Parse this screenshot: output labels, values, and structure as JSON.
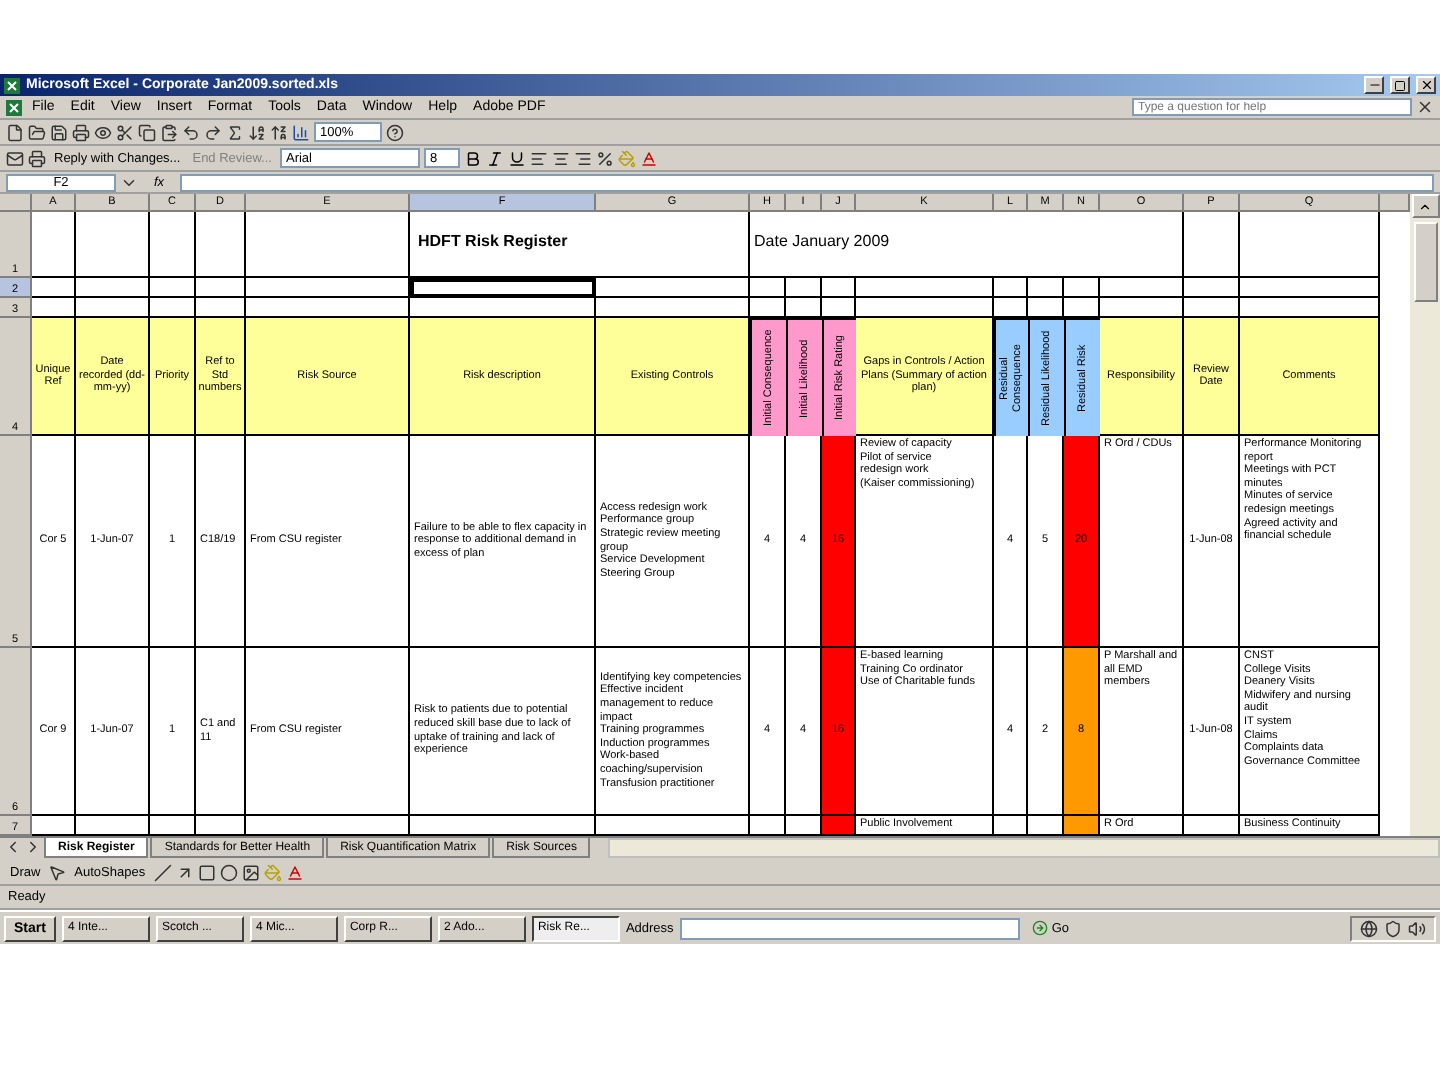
{
  "window": {
    "title": "Microsoft Excel - Corporate Jan2009.sorted.xls"
  },
  "menu": [
    "File",
    "Edit",
    "View",
    "Insert",
    "Format",
    "Tools",
    "Data",
    "Window",
    "Help",
    "Adobe PDF"
  ],
  "help_box": {
    "placeholder": "Type a question for help"
  },
  "toolbar": {
    "zoom": "100%",
    "review_buttons": [
      "Reply with Changes...",
      "End Review..."
    ],
    "font": "Arial",
    "font_size": "8"
  },
  "formula_bar": {
    "name_box": "F2",
    "fx": "fx"
  },
  "sheet": {
    "columns": [
      {
        "letter": "A",
        "selected": false
      },
      {
        "letter": "B",
        "selected": false
      },
      {
        "letter": "C",
        "selected": false
      },
      {
        "letter": "D",
        "selected": false
      },
      {
        "letter": "E",
        "selected": false
      },
      {
        "letter": "F",
        "selected": true
      },
      {
        "letter": "G",
        "selected": false
      },
      {
        "letter": "H",
        "selected": false
      },
      {
        "letter": "I",
        "selected": false
      },
      {
        "letter": "J",
        "selected": false
      },
      {
        "letter": "K",
        "selected": false
      },
      {
        "letter": "L",
        "selected": false
      },
      {
        "letter": "M",
        "selected": false
      },
      {
        "letter": "N",
        "selected": false
      },
      {
        "letter": "O",
        "selected": false
      },
      {
        "letter": "P",
        "selected": false
      },
      {
        "letter": "Q",
        "selected": false
      }
    ],
    "rows": [
      {
        "kind": "title",
        "number": "1",
        "selected": false,
        "title": "HDFT Risk Register",
        "date": "Date  January 2009"
      },
      {
        "kind": "blank",
        "number": "2",
        "selected": true
      },
      {
        "kind": "blank",
        "number": "3",
        "selected": false
      },
      {
        "kind": "header",
        "number": "4",
        "selected": false,
        "cells": [
          {
            "text": "Unique Ref",
            "vertical": false,
            "color": "#ffff99"
          },
          {
            "text": "Date recorded (dd-mm-yy)",
            "vertical": false,
            "color": "#ffff99"
          },
          {
            "text": "Priority",
            "vertical": false,
            "color": "#ffff99"
          },
          {
            "text": "Ref to Std numbers",
            "vertical": false,
            "color": "#ffff99"
          },
          {
            "text": "Risk Source",
            "vertical": false,
            "color": "#ffff99"
          },
          {
            "text": "Risk description",
            "vertical": false,
            "color": "#ffff99"
          },
          {
            "text": "Existing Controls",
            "vertical": false,
            "color": "#ffff99"
          },
          {
            "text": "Initial Consequence",
            "vertical": true,
            "color": "#ff99cc"
          },
          {
            "text": "Initial Likelihood",
            "vertical": true,
            "color": "#ff99cc"
          },
          {
            "text": "Initial Risk Rating",
            "vertical": true,
            "color": "#ff99cc"
          },
          {
            "text": "Gaps in Controls / Action Plans (Summary of action plan)",
            "vertical": false,
            "color": "#ffff99"
          },
          {
            "text": "Residual Consequence",
            "vertical": true,
            "color": "#99ccff"
          },
          {
            "text": "Residual Likelihood",
            "vertical": true,
            "color": "#99ccff"
          },
          {
            "text": "Residual Risk",
            "vertical": true,
            "color": "#99ccff"
          },
          {
            "text": "Responsibility",
            "vertical": false,
            "color": "#ffff99"
          },
          {
            "text": "Review Date",
            "vertical": false,
            "color": "#ffff99"
          },
          {
            "text": "Comments",
            "vertical": false,
            "color": "#ffff99"
          }
        ]
      },
      {
        "kind": "data",
        "number": "5",
        "selected": false,
        "cells": [
          {
            "text": "Cor 5"
          },
          {
            "text": "1-Jun-07"
          },
          {
            "text": "1"
          },
          {
            "text": "C18/19"
          },
          {
            "text": "From CSU register"
          },
          {
            "text": "Failure to be able to flex capacity in response to additional demand in excess of plan"
          },
          {
            "text": "Access redesign work\nPerformance group\nStrategic review meeting group\nService Development\nSteering Group"
          },
          {
            "text": "4"
          },
          {
            "text": "4"
          },
          {
            "text": "16",
            "color": "#ff0000"
          },
          {
            "text": "Review of capacity\nPilot of service\nredesign work\n(Kaiser commissioning)"
          },
          {
            "text": "4"
          },
          {
            "text": "5"
          },
          {
            "text": "20",
            "color": "#ff0000"
          },
          {
            "text": "R Ord / CDUs"
          },
          {
            "text": "1-Jun-08"
          },
          {
            "text": "Performance Monitoring report\nMeetings with PCT minutes\nMinutes of service redesign meetings\nAgreed activity and financial schedule"
          }
        ]
      },
      {
        "kind": "data",
        "number": "6",
        "selected": false,
        "cells": [
          {
            "text": "Cor 9"
          },
          {
            "text": "1-Jun-07"
          },
          {
            "text": "1"
          },
          {
            "text": "C1 and 11"
          },
          {
            "text": "From CSU register"
          },
          {
            "text": "Risk to patients due to potential reduced skill base due to lack of uptake of training and lack of experience"
          },
          {
            "text": "Identifying key competencies\nEffective incident management to reduce impact\nTraining programmes\nInduction programmes\nWork-based coaching/supervision\nTransfusion practitioner"
          },
          {
            "text": "4"
          },
          {
            "text": "4"
          },
          {
            "text": "16",
            "color": "#ff0000"
          },
          {
            "text": "E-based learning\nTraining Co ordinator\nUse of Charitable funds"
          },
          {
            "text": "4"
          },
          {
            "text": "2"
          },
          {
            "text": "8",
            "color": "#ff9900"
          },
          {
            "text": "P Marshall and all EMD members"
          },
          {
            "text": "1-Jun-08"
          },
          {
            "text": "CNST\nCollege Visits\nDeanery Visits\nMidwifery and nursing audit\nIT system\nClaims\nComplaints data\nGovernance Committee"
          }
        ]
      },
      {
        "kind": "data",
        "number": "7",
        "selected": false,
        "cells": [
          {},
          {},
          {},
          {},
          {},
          {},
          {},
          {},
          {},
          {
            "color": "#ff0000"
          },
          {
            "text": "Public Involvement"
          },
          {},
          {},
          {
            "color": "#ff9900"
          },
          {
            "text": "R Ord"
          },
          {},
          {
            "text": "Business Continuity"
          }
        ]
      }
    ]
  },
  "sheet_tabs": [
    {
      "label": "Risk Register",
      "selected": true
    },
    {
      "label": "Standards for Better Health",
      "selected": false
    },
    {
      "label": "Risk Quantification Matrix",
      "selected": false
    },
    {
      "label": "Risk Sources",
      "selected": false
    }
  ],
  "drawing_toolbar": {
    "draw": "Draw",
    "autoshapes": "AutoShapes"
  },
  "status_bar": {
    "text": "Ready"
  },
  "taskbar": {
    "start": "Start",
    "tasks": [
      {
        "label": "4 Inte...",
        "selected": false
      },
      {
        "label": "Scotch ...",
        "selected": false
      },
      {
        "label": "4 Mic...",
        "selected": false
      },
      {
        "label": "Corp R...",
        "selected": false
      },
      {
        "label": "2 Ado...",
        "selected": false
      },
      {
        "label": "Risk Re...",
        "selected": true
      }
    ],
    "address_label": "Address",
    "go": "Go"
  }
}
